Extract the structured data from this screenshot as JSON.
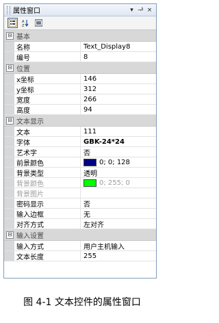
{
  "window": {
    "title": "属性窗口",
    "dropdown_glyph": "▾",
    "pin_glyph": "ᅷ",
    "close_glyph": "×"
  },
  "toolbar": {
    "categorized_icon": "categorized-icon",
    "alphabetical_icon": "sort-az-icon",
    "pages_icon": "property-pages-icon"
  },
  "categories": {
    "basic": {
      "label": "基本",
      "collapse": "⊟"
    },
    "position": {
      "label": "位置",
      "collapse": "⊟"
    },
    "text_display": {
      "label": "文本显示",
      "collapse": "⊟"
    },
    "input_settings": {
      "label": "输入设置",
      "collapse": "⊟"
    }
  },
  "basic": {
    "name": {
      "label": "名称",
      "value": "Text_Display8"
    },
    "number": {
      "label": "编号",
      "value": "8"
    }
  },
  "position": {
    "x": {
      "label": "x坐标",
      "value": "146"
    },
    "y": {
      "label": "y坐标",
      "value": "312"
    },
    "width": {
      "label": "宽度",
      "value": "266"
    },
    "height": {
      "label": "高度",
      "value": "94"
    }
  },
  "text_display": {
    "text": {
      "label": "文本",
      "value": "111"
    },
    "font": {
      "label": "字体",
      "value": "GBK-24*24"
    },
    "art_font": {
      "label": "艺术字",
      "value": "否"
    },
    "fg_color": {
      "label": "前景颜色",
      "value": "0; 0; 128",
      "color": "#000080"
    },
    "bg_type": {
      "label": "背景类型",
      "value": "透明"
    },
    "bg_color": {
      "label": "背景颜色",
      "value": "0; 255; 0",
      "color": "#00ff00"
    },
    "bg_image": {
      "label": "背景图片",
      "value": ""
    },
    "password": {
      "label": "密码显示",
      "value": "否"
    },
    "input_border": {
      "label": "输入边框",
      "value": "无"
    },
    "align": {
      "label": "对齐方式",
      "value": "左对齐"
    }
  },
  "input_settings": {
    "method": {
      "label": "输入方式",
      "value": "用户主机输入"
    },
    "length": {
      "label": "文本长度",
      "value": "255"
    }
  },
  "caption": "图 4-1 文本控件的属性窗口"
}
